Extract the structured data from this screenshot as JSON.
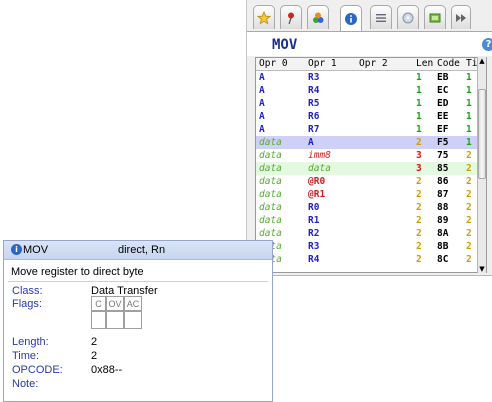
{
  "toolbar": {
    "tabs": [
      {
        "icon": "star-icon"
      },
      {
        "icon": "pin-icon"
      },
      {
        "icon": "colors-icon"
      },
      {
        "icon": "info-icon",
        "active": true
      },
      {
        "icon": "list-icon"
      },
      {
        "icon": "tag-icon"
      },
      {
        "icon": "chip-icon"
      },
      {
        "icon": "fast-forward-icon"
      }
    ]
  },
  "header": {
    "title": "MOV",
    "help": "?"
  },
  "table": {
    "columns": [
      "Opr 0",
      "Opr 1",
      "Opr 2",
      "Len",
      "Code",
      "Tim"
    ],
    "rows": [
      {
        "o0": "A",
        "o0c": "reg",
        "o1": "R3",
        "o1c": "reg",
        "o2": "",
        "len": "1",
        "code": "EB",
        "tim": "1",
        "state": ""
      },
      {
        "o0": "A",
        "o0c": "reg",
        "o1": "R4",
        "o1c": "reg",
        "o2": "",
        "len": "1",
        "code": "EC",
        "tim": "1",
        "state": ""
      },
      {
        "o0": "A",
        "o0c": "reg",
        "o1": "R5",
        "o1c": "reg",
        "o2": "",
        "len": "1",
        "code": "ED",
        "tim": "1",
        "state": ""
      },
      {
        "o0": "A",
        "o0c": "reg",
        "o1": "R6",
        "o1c": "reg",
        "o2": "",
        "len": "1",
        "code": "EE",
        "tim": "1",
        "state": ""
      },
      {
        "o0": "A",
        "o0c": "reg",
        "o1": "R7",
        "o1c": "reg",
        "o2": "",
        "len": "1",
        "code": "EF",
        "tim": "1",
        "state": ""
      },
      {
        "o0": "data",
        "o0c": "dat",
        "o1": "A",
        "o1c": "reg",
        "o2": "",
        "len": "2",
        "code": "F5",
        "tim": "1",
        "state": "selected"
      },
      {
        "o0": "data",
        "o0c": "dat",
        "o1": "imm8",
        "o1c": "imm",
        "o2": "",
        "len": "3",
        "code": "75",
        "tim": "2",
        "state": ""
      },
      {
        "o0": "data",
        "o0c": "dat",
        "o1": "data",
        "o1c": "dat",
        "o2": "",
        "len": "3",
        "code": "85",
        "tim": "2",
        "state": "highlight"
      },
      {
        "o0": "data",
        "o0c": "dat",
        "o1": "@R0",
        "o1c": "ind",
        "o2": "",
        "len": "2",
        "code": "86",
        "tim": "2",
        "state": ""
      },
      {
        "o0": "data",
        "o0c": "dat",
        "o1": "@R1",
        "o1c": "ind",
        "o2": "",
        "len": "2",
        "code": "87",
        "tim": "2",
        "state": ""
      },
      {
        "o0": "data",
        "o0c": "dat",
        "o1": "R0",
        "o1c": "reg",
        "o2": "",
        "len": "2",
        "code": "88",
        "tim": "2",
        "state": ""
      },
      {
        "o0": "data",
        "o0c": "dat",
        "o1": "R1",
        "o1c": "reg",
        "o2": "",
        "len": "2",
        "code": "89",
        "tim": "2",
        "state": ""
      },
      {
        "o0": "data",
        "o0c": "dat",
        "o1": "R2",
        "o1c": "reg",
        "o2": "",
        "len": "2",
        "code": "8A",
        "tim": "2",
        "state": ""
      },
      {
        "o0": "data",
        "o0c": "dat",
        "o1": "R3",
        "o1c": "reg",
        "o2": "",
        "len": "2",
        "code": "8B",
        "tim": "2",
        "state": ""
      },
      {
        "o0": "data",
        "o0c": "dat",
        "o1": "R4",
        "o1c": "reg",
        "o2": "",
        "len": "2",
        "code": "8C",
        "tim": "2",
        "state": ""
      }
    ]
  },
  "tooltip": {
    "mnemonic": "MOV",
    "operands": "direct, Rn",
    "description": "Move register to direct byte",
    "class_label": "Class:",
    "class_value": "Data Transfer",
    "flags_label": "Flags:",
    "flags": [
      "C",
      "OV",
      "AC"
    ],
    "length_label": "Length:",
    "length_value": "2",
    "time_label": "Time:",
    "time_value": "2",
    "opcode_label": "OPCODE:",
    "opcode_value": "0x88--",
    "note_label": "Note:",
    "note_value": ""
  }
}
